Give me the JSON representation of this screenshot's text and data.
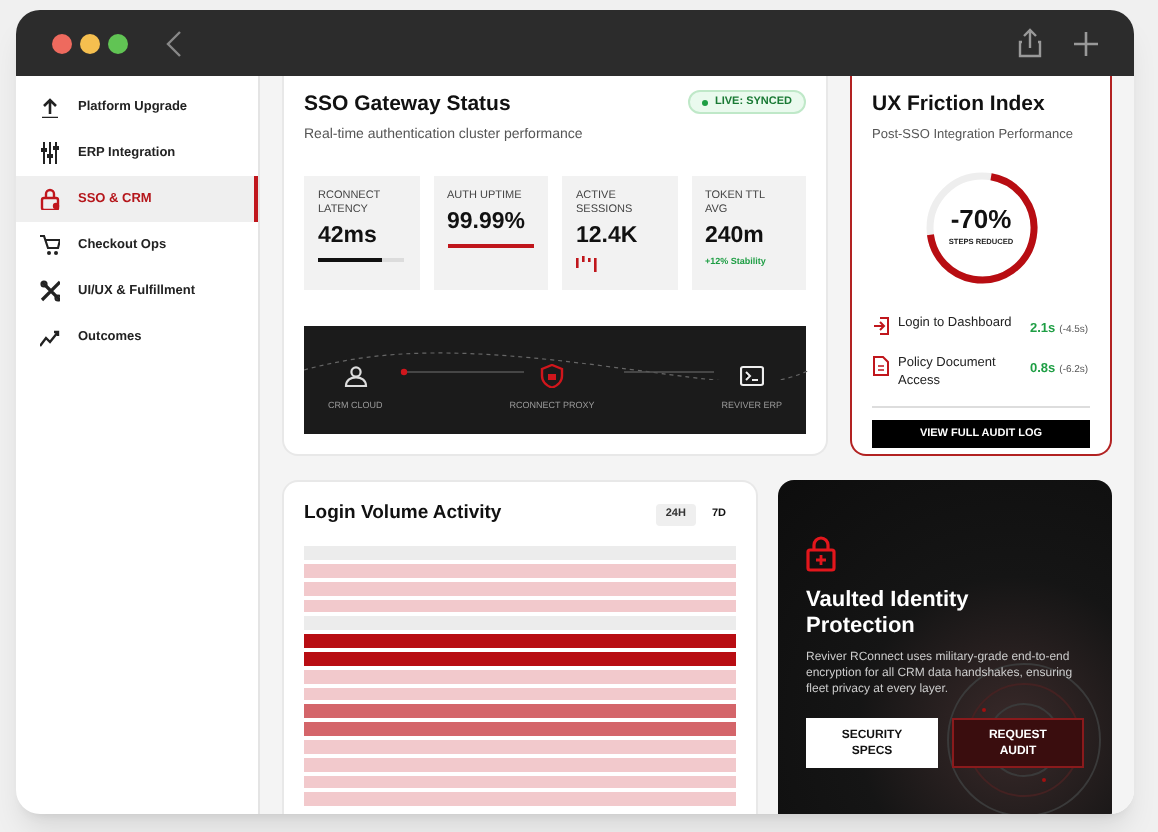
{
  "sidebar": {
    "items": [
      {
        "label": "Platform Upgrade",
        "kind": "upload",
        "selected": false
      },
      {
        "label": "ERP Integration",
        "kind": "sliders",
        "selected": false
      },
      {
        "label": "SSO & CRM",
        "kind": "lock",
        "selected": true
      },
      {
        "label": "Checkout Ops",
        "kind": "cart",
        "selected": false
      },
      {
        "label": "UI/UX & Fulfillment",
        "kind": "tools",
        "selected": false
      },
      {
        "label": "Outcomes",
        "kind": "trend",
        "selected": false
      }
    ]
  },
  "gateway": {
    "title": "SSO Gateway Status",
    "subtitle": "Real-time authentication cluster performance",
    "badge": "LIVE: SYNCED",
    "metrics": [
      {
        "label": "RCONNECT LATENCY",
        "value": "42ms",
        "kind": "bar",
        "level": 0.75
      },
      {
        "label": "AUTH UPTIME",
        "value": "99.99%",
        "kind": "line"
      },
      {
        "label": "ACTIVE SESSIONS",
        "value": "12.4K",
        "kind": "spark"
      },
      {
        "label": "TOKEN TTL AVG",
        "value": "240m",
        "kind": "note",
        "note": "+12% Stability"
      }
    ],
    "flow": [
      {
        "label": "CRM CLOUD",
        "kind": "cloud"
      },
      {
        "label": "RCONNECT PROXY",
        "kind": "shield"
      },
      {
        "label": "REVIVER ERP",
        "kind": "terminal"
      }
    ]
  },
  "friction": {
    "title": "UX Friction Index",
    "subtitle": "Post-SSO Integration Performance",
    "gauge": {
      "value": "-70%",
      "caption": "STEPS REDUCED",
      "level": 0.7
    },
    "rows": [
      {
        "label": "Login to Dashboard",
        "kind": "login",
        "value": "2.1s",
        "delta": "(-4.5s)"
      },
      {
        "label": "Policy Document Access",
        "kind": "document",
        "value": "0.8s",
        "delta": "(-6.2s)"
      }
    ],
    "button": "VIEW FULL AUDIT LOG"
  },
  "activity": {
    "title": "Login Volume Activity",
    "tabs": [
      {
        "label": "24H",
        "selected": true
      },
      {
        "label": "7D",
        "selected": false
      }
    ],
    "stripes": [
      {
        "color": "#ececec"
      },
      {
        "color": "#f2c9cc"
      },
      {
        "color": "#f2c9cc"
      },
      {
        "color": "#f2c9cc"
      },
      {
        "color": "#ececec"
      },
      {
        "color": "#b80d12"
      },
      {
        "color": "#b80d12"
      },
      {
        "color": "#f2c9cc"
      },
      {
        "color": "#f2c9cc"
      },
      {
        "color": "#d4656a"
      },
      {
        "color": "#d4656a"
      },
      {
        "color": "#f2c9cc"
      },
      {
        "color": "#f2c9cc"
      },
      {
        "color": "#f2c9cc"
      },
      {
        "color": "#f2c9cc"
      }
    ]
  },
  "vault": {
    "title": "Vaulted Identity Protection",
    "body": "Reviver RConnect uses military-grade end-to-end encryption for all CRM data handshakes, ensuring fleet privacy at every layer.",
    "buttons": [
      {
        "label": "SECURITY SPECS",
        "kind": "light"
      },
      {
        "label": "REQUEST AUDIT",
        "kind": "dark"
      }
    ]
  }
}
